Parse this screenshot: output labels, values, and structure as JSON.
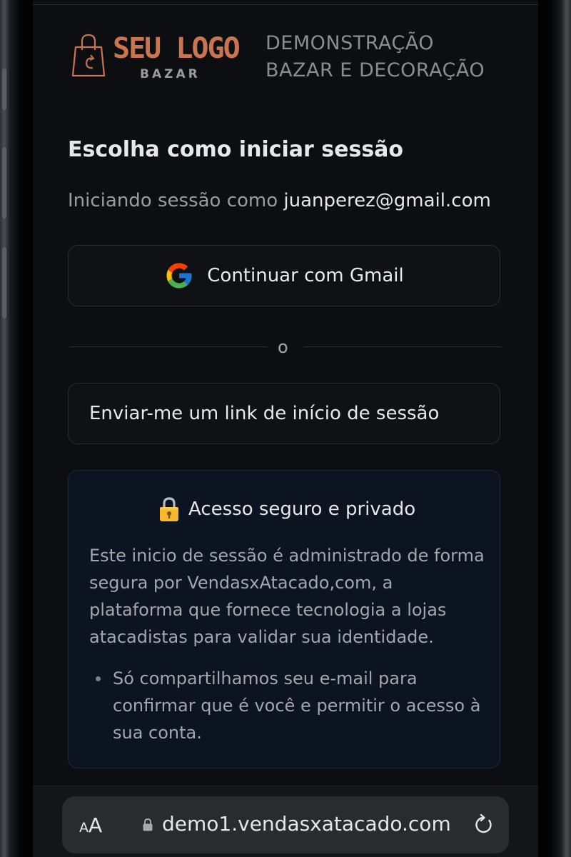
{
  "header": {
    "logo_text": "SEU LOGO",
    "logo_subtext": "BAZAR",
    "store_name_line1": "DEMONSTRAÇÃO",
    "store_name_line2": "BAZAR E DECORAÇÃO"
  },
  "main": {
    "title": "Escolha como iniciar sessão",
    "session_prefix": "Iniciando sessão como",
    "session_email": "juanperez@gmail.com",
    "gmail_button_label": "Continuar com Gmail",
    "divider_text": "o",
    "magic_link_button_label": "Enviar-me um link de início de sessão"
  },
  "info_card": {
    "title": "Acesso seguro e privado",
    "body": "Este inicio de sessão é administrado de forma segura por VendasxAtacado,com, a plataforma que fornece tecnologia a lojas atacadistas para validar sua identidade.",
    "bullet": "Só compartilhamos seu e-mail para confirmar que é você e permitir o acesso à sua conta."
  },
  "browser_bar": {
    "aa_small": "A",
    "aa_large": "A",
    "url": "demo1.vendasxatacado.com"
  },
  "icons": {
    "logo": "shopping-bag-icon",
    "google": "google-g-icon",
    "lock": "lock-icon",
    "url_lock": "padlock-icon",
    "reload": "reload-icon"
  },
  "colors": {
    "background": "#0d0e11",
    "logo_accent": "#c9754f",
    "info_card_background": "#0b1420",
    "button_border": "#2b2d31"
  }
}
